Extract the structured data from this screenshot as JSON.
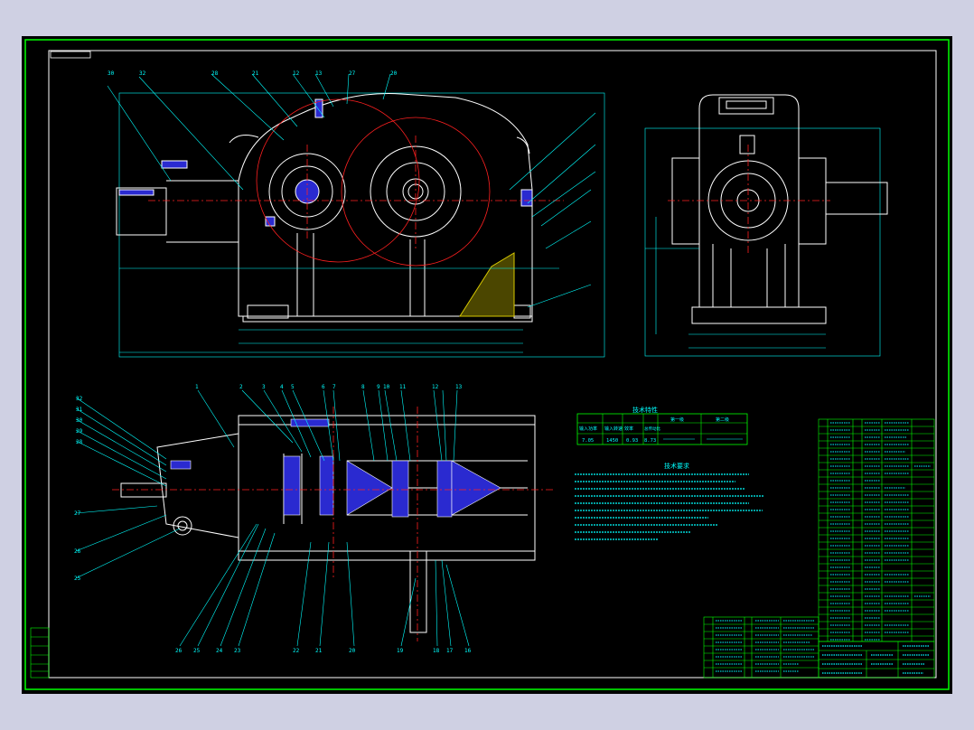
{
  "window": {
    "canvas_bg": "#000000",
    "workspace_bg": "#cfd0e3"
  },
  "colors": {
    "frame": "#00ff00",
    "outline": "#ffffff",
    "leader": "#00ffff",
    "center": "#ff2020",
    "fill_blue": "#2a2ad0",
    "oil": "#d7c800",
    "table_text": "#00ffff",
    "table_line": "#00ff00"
  },
  "tech_params": {
    "title": "技术特性",
    "headers": [
      "输入功率",
      "输入转速",
      "效率",
      "总传动比",
      "第一级",
      "第二级"
    ],
    "values": [
      "7.05",
      "1450",
      "0.93",
      "8.73"
    ]
  },
  "tech_requirements": {
    "title": "技术要求"
  },
  "balloons_top": [
    "30",
    "32",
    "28",
    "21",
    "12",
    "13",
    "27",
    "20"
  ],
  "balloons_plan_top": [
    "1",
    "2",
    "3",
    "4",
    "5",
    "6",
    "7",
    "8",
    "9",
    "10",
    "11",
    "12",
    "13"
  ],
  "balloons_plan_bottom": [
    "26",
    "25",
    "24",
    "23",
    "22",
    "21",
    "20",
    "19",
    "18",
    "17",
    "16"
  ]
}
